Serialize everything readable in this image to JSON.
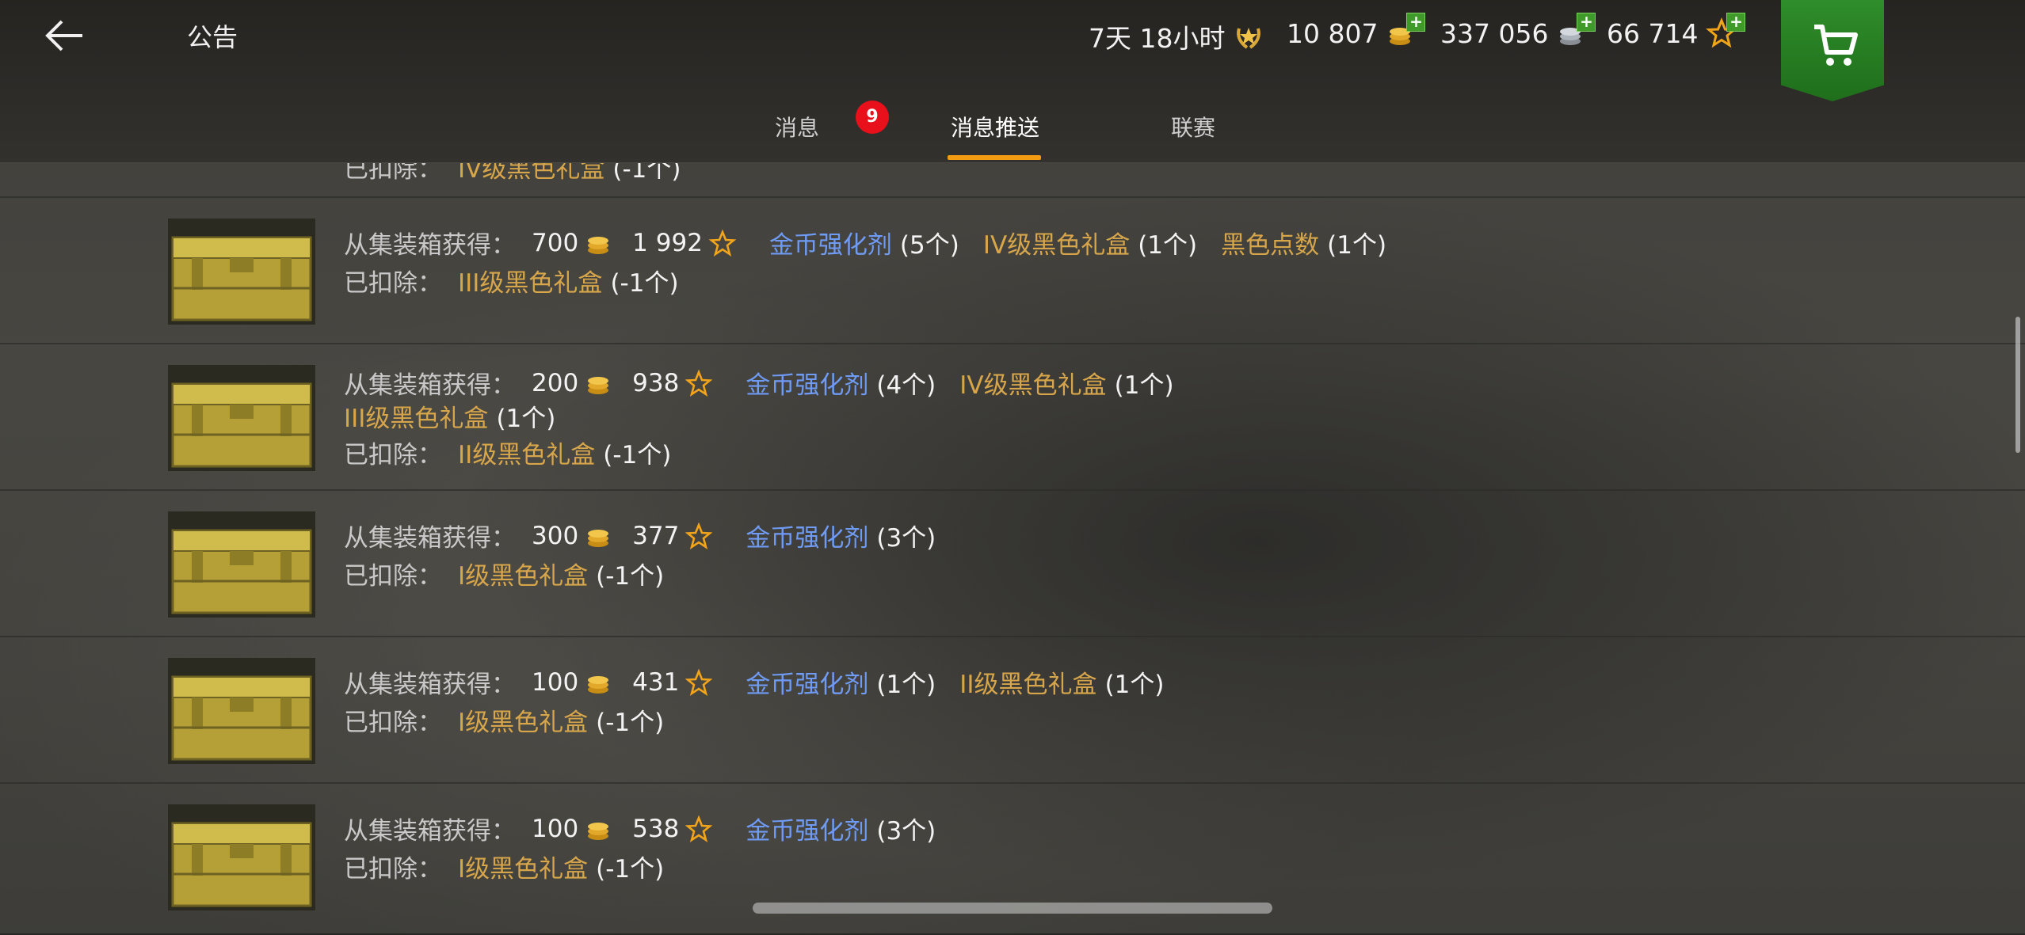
{
  "header": {
    "title": "公告",
    "timer": "7天 18小时",
    "gold": "10 807",
    "silver": "337 056",
    "xp": "66 714"
  },
  "tabs": [
    {
      "label": "消息"
    },
    {
      "label": "消息推送"
    },
    {
      "label": "联赛"
    }
  ],
  "badge_count": "9",
  "labels": {
    "obtained": "从集装箱获得：",
    "deducted": "已扣除："
  },
  "rows": [
    {
      "gold": "700",
      "xp": "1 992",
      "items": [
        {
          "name": "金币强化剂",
          "count": "(5个)",
          "color": "#6f9bf5"
        },
        {
          "name": "IV级黑色礼盒",
          "count": "(1个)",
          "color": "#d8a64a"
        },
        {
          "name": "黑色点数",
          "count": "(1个)",
          "color": "#d8a64a"
        }
      ],
      "deduct_name": "III级黑色礼盒",
      "deduct_count": "(-1个)"
    },
    {
      "gold": "200",
      "xp": "938",
      "items": [
        {
          "name": "金币强化剂",
          "count": "(4个)",
          "color": "#6f9bf5"
        },
        {
          "name": "IV级黑色礼盒",
          "count": "(1个)",
          "color": "#d8a64a"
        }
      ],
      "extra_item": {
        "name": "III级黑色礼盒",
        "count": "(1个)"
      },
      "deduct_name": "II级黑色礼盒",
      "deduct_count": "(-1个)"
    },
    {
      "gold": "300",
      "xp": "377",
      "items": [
        {
          "name": "金币强化剂",
          "count": "(3个)",
          "color": "#6f9bf5"
        }
      ],
      "deduct_name": "I级黑色礼盒",
      "deduct_count": "(-1个)"
    },
    {
      "gold": "100",
      "xp": "431",
      "items": [
        {
          "name": "金币强化剂",
          "count": "(1个)",
          "color": "#6f9bf5"
        },
        {
          "name": "II级黑色礼盒",
          "count": "(1个)",
          "color": "#d8a64a"
        }
      ],
      "deduct_name": "I级黑色礼盒",
      "deduct_count": "(-1个)"
    },
    {
      "gold": "100",
      "xp": "538",
      "items": [
        {
          "name": "金币强化剂",
          "count": "(3个)",
          "color": "#6f9bf5"
        }
      ],
      "deduct_name": "I级黑色礼盒",
      "deduct_count": "(-1个)"
    }
  ],
  "partial_row": {
    "deduct_name": "IV级黑色礼盒",
    "deduct_count": "(-1个)"
  },
  "icons": {
    "back": "back-arrow-icon",
    "gold": "gold-coin-icon",
    "silver": "silver-coin-icon",
    "xp": "star-icon",
    "timer": "premium-laurel-icon",
    "shop": "cart-icon"
  }
}
